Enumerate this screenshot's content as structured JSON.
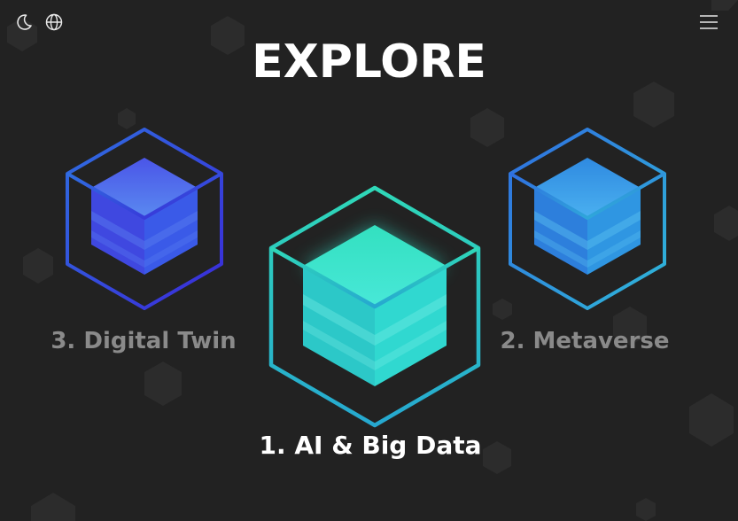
{
  "header": {
    "title": "EXPLORE",
    "theme_toggle_icon": "moon-icon",
    "language_icon": "globe-icon",
    "menu_icon": "hamburger-menu-icon"
  },
  "carousel": {
    "items": [
      {
        "label": "1. AI & Big Data",
        "state": "active",
        "color": "#2fd8c0"
      },
      {
        "label": "2. Metaverse",
        "state": "inactive",
        "color": "#2f8ae0"
      },
      {
        "label": "3. Digital Twin",
        "state": "inactive",
        "color": "#4a3ae0"
      }
    ]
  },
  "colors": {
    "background": "#222222",
    "title": "#ffffff",
    "inactive_label": "#8a8a8a",
    "active_label": "#ffffff"
  }
}
